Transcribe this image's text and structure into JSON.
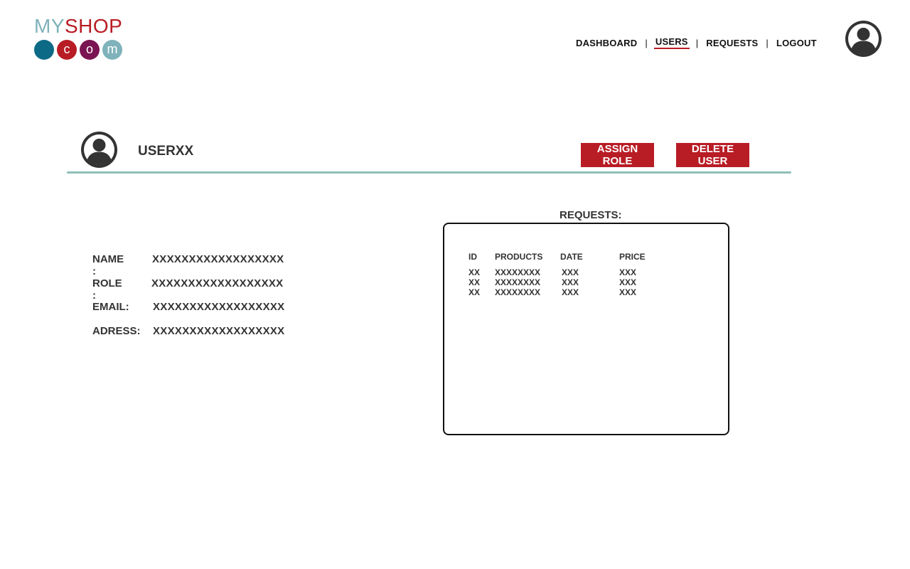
{
  "brand": {
    "my": "MY",
    "shop": "SHOP",
    "dots": [
      {
        "letter": "",
        "color": "#0d6a87"
      },
      {
        "letter": "c",
        "color": "#b81c24"
      },
      {
        "letter": "o",
        "color": "#7a1452"
      },
      {
        "letter": "m",
        "color": "#7fb2bb"
      }
    ]
  },
  "nav": {
    "items": [
      {
        "label": "DASHBOARD",
        "active": false
      },
      {
        "label": "USERS",
        "active": true
      },
      {
        "label": "REQUESTS",
        "active": false
      },
      {
        "label": "LOGOUT",
        "active": false
      }
    ],
    "separator": "|"
  },
  "account": {
    "icon": "user-circle-icon"
  },
  "user": {
    "name": "USERXX",
    "icon": "user-circle-icon",
    "assign_role_label": "ASSIGN ROLE",
    "delete_user_label": "DELETE USER",
    "details": [
      {
        "label": "NAME :",
        "value": "XXXXXXXXXXXXXXXXXX"
      },
      {
        "label": "ROLE :",
        "value": "XXXXXXXXXXXXXXXXXX"
      },
      {
        "label": "EMAIL:",
        "value": "XXXXXXXXXXXXXXXXXX"
      },
      {
        "label": "ADRESS:",
        "value": "XXXXXXXXXXXXXXXXXX"
      }
    ]
  },
  "requests": {
    "title": "REQUESTS:",
    "columns": [
      "ID",
      "PRODUCTS",
      "DATE",
      "PRICE"
    ],
    "rows": [
      [
        "XX",
        "XXXXXXXX",
        "XXX",
        "XXX"
      ],
      [
        "XX",
        "XXXXXXXX",
        "XXX",
        "XXX"
      ],
      [
        "XX",
        "XXXXXXXX",
        "XXX",
        "XXX"
      ]
    ]
  },
  "colors": {
    "brand_red": "#b81c24",
    "divider_teal": "#8dbfb9",
    "text_dark": "#333333"
  }
}
